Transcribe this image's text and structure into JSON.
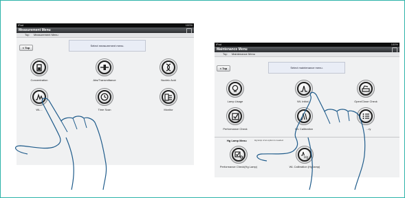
{
  "left": {
    "status": {
      "left": "iPad",
      "right": "100%"
    },
    "title": "Measurement Menu",
    "crumbs": [
      "Top",
      "Measurement Menu"
    ],
    "top_button": "< Top",
    "message": "Select measurement menu.",
    "items": [
      {
        "label": "Concentration",
        "icon": "cuvette-icon"
      },
      {
        "label": "Abs/Transmittance",
        "icon": "beam-sample-icon"
      },
      {
        "label": "Nucleic Acid",
        "icon": "dna-helix-icon"
      },
      {
        "label": "WL...",
        "icon": "wavelength-scan-icon"
      },
      {
        "label": "Time Scan",
        "icon": "clock-icon"
      },
      {
        "label": "Monitor",
        "icon": "monitor-icon"
      }
    ]
  },
  "right": {
    "status": {
      "left": "iPad",
      "right": "100%"
    },
    "title": "Maintenance Menu",
    "crumbs": [
      "Top",
      "Maintenance Menu"
    ],
    "top_button": "< Top",
    "message": "Select maintenance menu.",
    "items": [
      {
        "label": "Lamp Usage",
        "icon": "lamp-icon"
      },
      {
        "label": "WL Initial...",
        "icon": "wavelength-peak-icon"
      },
      {
        "label": "Open/Close Check",
        "icon": "open-close-icon"
      },
      {
        "label": "Performance Check",
        "icon": "checkbox-icon"
      },
      {
        "label": "WL Calibration",
        "icon": "calibration-icon"
      },
      {
        "label": "...ry",
        "icon": "list-icon"
      }
    ],
    "hg_section": {
      "title": "Hg Lamp Menu",
      "note": "Hg lamp of an option is needed.",
      "items": [
        {
          "label": "Performance Check(Hg Lamp)",
          "icon": "hg-check-icon"
        },
        {
          "label": "WL Calibration (Hg lamp)",
          "icon": "hg-calibration-icon"
        }
      ]
    }
  }
}
